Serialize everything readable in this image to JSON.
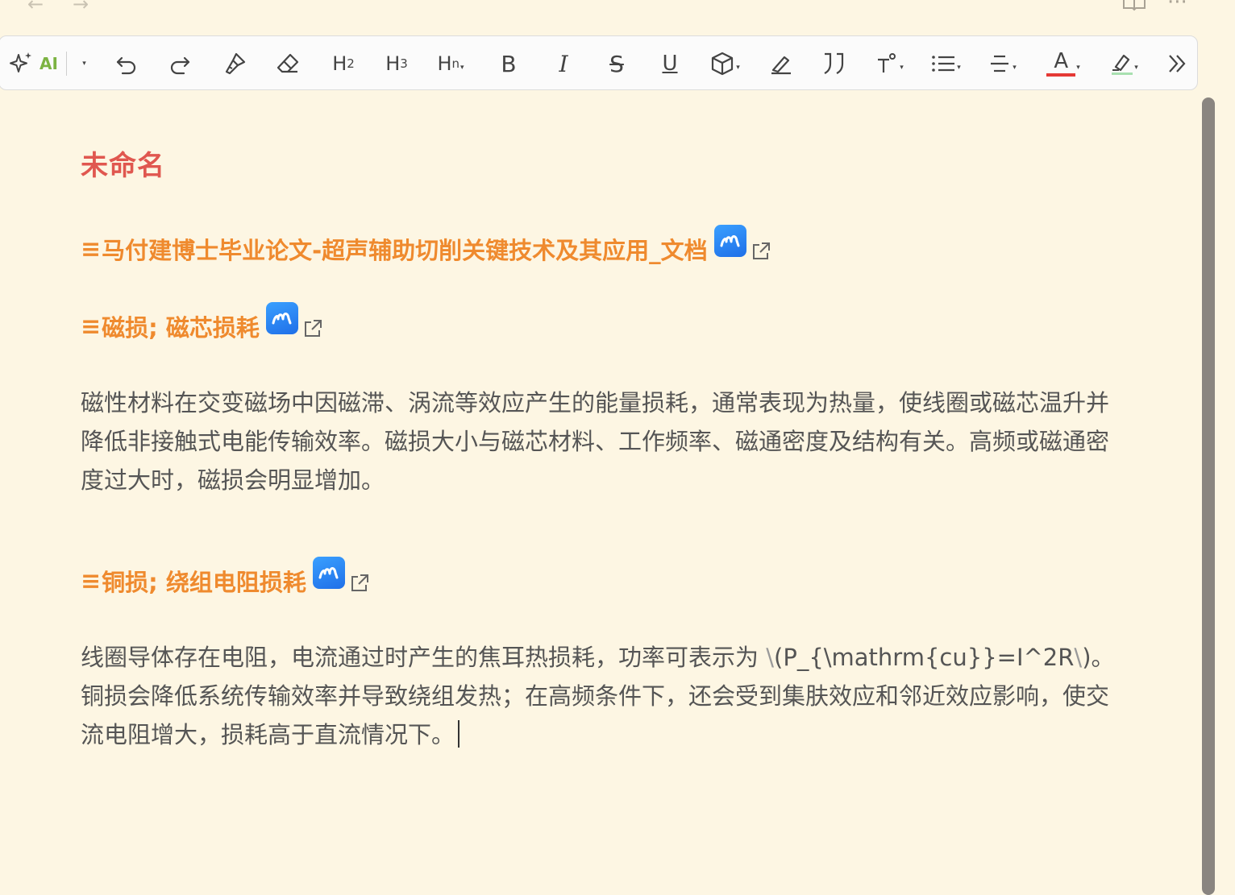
{
  "toolbar": {
    "ai_label": "AI",
    "h2_label": "H",
    "h2_sub": "2",
    "h3_label": "H",
    "h3_sub": "3",
    "hn_label": "H",
    "hn_sub": "n",
    "bold_label": "B",
    "italic_label": "I",
    "strike_label": "S",
    "underline_label": "U",
    "font_color_label": "A",
    "font_color_swatch": "#e53935",
    "highlight_swatch": "#a8e0b0",
    "icons": [
      "sparkle-icon",
      "undo-icon",
      "redo-icon",
      "format-painter-icon",
      "eraser-icon",
      "cube-icon",
      "pen-icon",
      "quote-icon",
      "text-size-icon",
      "list-icon",
      "align-icon",
      "highlighter-icon",
      "more-icon"
    ]
  },
  "document": {
    "title": "未命名",
    "links": [
      {
        "prefix": "≡",
        "text": "马付建博士毕业论文-超声辅助切削关键技术及其应用_文档"
      },
      {
        "prefix": "≡",
        "text": "磁损; 磁芯损耗"
      },
      {
        "prefix": "≡",
        "text": "铜损; 绕组电阻损耗"
      }
    ],
    "para1": "磁性材料在交变磁场中因磁滞、涡流等效应产生的能量损耗，通常表现为热量，使线圈或磁芯温升并降低非接触式电能传输效率。磁损大小与磁芯材料、工作频率、磁通密度及结构有关。高频或磁通密度过大时，磁损会明显增加。",
    "para2_a": "线圈导体存在电阻，电流通过时产生的焦耳热损耗，功率可表示为 ",
    "para2_b": "\\",
    "para2_c": "(P_{\\mathrm{cu}}=I^2R",
    "para2_d": "\\",
    "para2_e": ")。铜损会降低系统传输效率并导致绕组发热；在高频条件下，还会受到集肤效应和邻近效应影响，使交流电阻增大，损耗高于直流情况下。"
  },
  "colors": {
    "background": "#fdf6e3",
    "title": "#e0574f",
    "link": "#ef8a2e",
    "ai": "#7cb342",
    "badge": "#2b88f5"
  }
}
